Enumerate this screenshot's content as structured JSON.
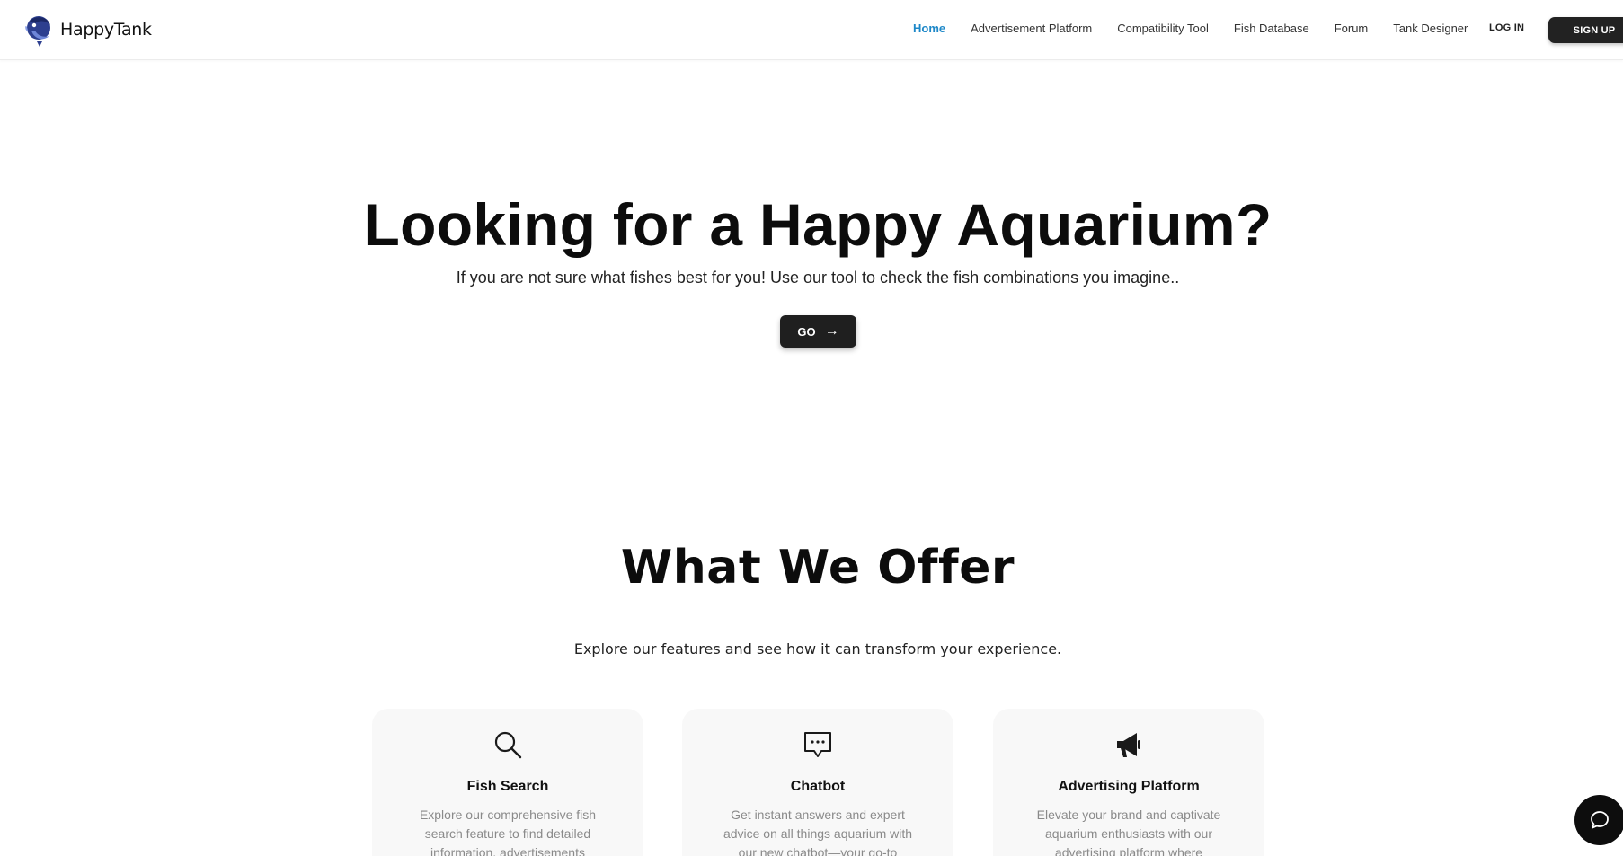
{
  "brand": {
    "name": "HappyTank",
    "logo_icon": "fish-logo-icon"
  },
  "nav": {
    "items": [
      {
        "label": "Home",
        "active": true
      },
      {
        "label": "Advertisement Platform",
        "active": false
      },
      {
        "label": "Compatibility Tool",
        "active": false
      },
      {
        "label": "Fish Database",
        "active": false
      },
      {
        "label": "Forum",
        "active": false
      },
      {
        "label": "Tank Designer",
        "active": false
      }
    ],
    "login_label": "LOG IN",
    "signup_label": "SIGN UP"
  },
  "hero": {
    "title": "Looking for a Happy Aquarium?",
    "subtitle": "If you are not sure what fishes best for you! Use our tool to check the fish combinations you imagine..",
    "cta_label": "GO",
    "cta_icon": "arrow-right-icon"
  },
  "offer": {
    "title": "What We Offer",
    "subtitle": "Explore our features and see how it can transform your experience.",
    "cards": [
      {
        "icon": "search-icon",
        "title": "Fish Search",
        "text": "Explore our comprehensive fish search feature to find detailed information, advertisements"
      },
      {
        "icon": "chat-bubble-icon",
        "title": "Chatbot",
        "text": "Get instant answers and expert advice on all things aquarium with our new chatbot—your go-to"
      },
      {
        "icon": "megaphone-icon",
        "title": "Advertising Platform",
        "text": "Elevate your brand and captivate aquarium enthusiasts with our advertising platform where"
      }
    ]
  },
  "chat_widget": {
    "icon": "chat-icon"
  },
  "colors": {
    "accent": "#1e88c8",
    "button_dark": "#222222",
    "card_bg": "#f8f8f8",
    "muted_text": "#8a8a8a"
  }
}
